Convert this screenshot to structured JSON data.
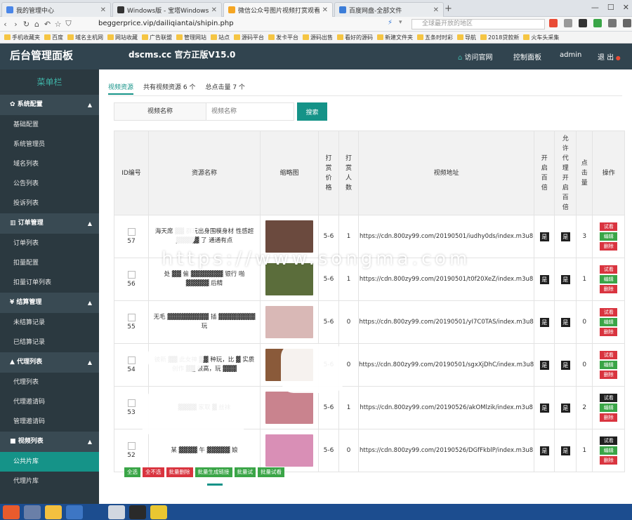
{
  "browser": {
    "tabs": [
      {
        "label": "我的管理中心",
        "icon_color": "#4a86e8"
      },
      {
        "label": "Windows版 - 宝塔Windows面板",
        "icon_color": "#333333"
      },
      {
        "label": "微信公众号图片视频打赏观看电影",
        "icon_color": "#f5a623"
      },
      {
        "label": "百度网盘-全部文件",
        "icon_color": "#3b7dd8"
      }
    ],
    "url": "beggerprice.vip/dailiqiantai/shipin.php",
    "search_placeholder": "全球最开放的地区",
    "bookmarks": [
      "手机收藏夹",
      "百度",
      "域名主机网",
      "网站收藏",
      "广告联盟",
      "管理网站",
      "站点",
      "源码平台",
      "发卡平台",
      "源码出售",
      "看好的源码",
      "新建文件夹",
      "五条时时彩",
      "导航",
      "2018贷款新",
      "火车头采集"
    ]
  },
  "header": {
    "brand": "后台管理面板",
    "title": "dscms.cc 官方正版V15.0",
    "visit_site": "访问官网",
    "control_panel": "控制面板",
    "user": "admin",
    "logout": "退 出"
  },
  "sidebar": {
    "title": "菜单栏",
    "sections": [
      {
        "label": "系统配置",
        "items": [
          "基础配置",
          "系统管理员",
          "域名列表",
          "公告列表",
          "投诉列表"
        ]
      },
      {
        "label": "订单管理",
        "items": [
          "订单列表",
          "扣量配置",
          "扣量订单列表"
        ]
      },
      {
        "label": "结算管理",
        "items": [
          "未结算记录",
          "已结算记录"
        ]
      },
      {
        "label": "代理列表",
        "items": [
          "代理列表",
          "代理邀请码",
          "管理邀请码"
        ]
      },
      {
        "label": "视频列表",
        "items": [
          "公共片库",
          "代理片库"
        ]
      }
    ],
    "active_item": "公共片库"
  },
  "main": {
    "tabs": [
      "视频资源",
      "共有视频资源 6 个",
      "总点击量 7 个"
    ],
    "filter": {
      "label": "视频名称",
      "placeholder": "视频名称",
      "button": "搜索"
    },
    "columns": [
      "ID编号",
      "资源名称",
      "缩略图",
      "打赏价格",
      "打赏人数",
      "视频地址",
      "开启百倍",
      "允许代理开启百倍",
      "点击量",
      "操作"
    ],
    "rows": [
      {
        "id": "57",
        "name": "海天席 ▓▓ 群玩出身围模身材 性感超 ▓▓▓▓▓ 了 通通有点",
        "thumb_color": "#6b4a3e",
        "price": "5-6",
        "count": "1",
        "url": "https://cdn.800zy99.com/20190501/iudhy0ds/index.m3u8",
        "hundred": "是",
        "agent_hundred": "是",
        "clicks": "3",
        "ops": [
          "试看",
          "编辑",
          "删除"
        ],
        "ops_first_color": "red"
      },
      {
        "id": "56",
        "name": "处 ▓▓ 偷 ▓▓▓▓▓▓▓ 银行 啪 ▓▓▓▓▓ 后精",
        "thumb_color": "#5b6d3b",
        "price": "5-6",
        "count": "1",
        "url": "https://cdn.800zy99.com/20190501/t0f20XeZ/index.m3u8",
        "hundred": "是",
        "agent_hundred": "是",
        "clicks": "1",
        "ops": [
          "试看",
          "编辑",
          "删除"
        ],
        "ops_first_color": "red"
      },
      {
        "id": "55",
        "name": "无毛 ▓▓▓▓▓▓▓▓▓ 插 ▓▓▓▓▓▓▓▓ 玩",
        "thumb_color": "#d9b8b6",
        "price": "5-6",
        "count": "0",
        "url": "https://cdn.800zy99.com/20190501/yI7C0TAS/index.m3u8",
        "hundred": "是",
        "agent_hundred": "是",
        "clicks": "0",
        "ops": [
          "试看",
          "编辑",
          "删除"
        ],
        "ops_first_color": "red"
      },
      {
        "id": "54",
        "name": "彼新 ▓▓ 此女神 ▓▓ 种玩，比 ▓ 实质创作 ▓▓ 很高，玩 ▓▓▓",
        "thumb_color": "#8a5a3a",
        "price": "5-6",
        "count": "0",
        "url": "https://cdn.800zy99.com/20190501/sgxXjDhC/index.m3u8",
        "hundred": "是",
        "agent_hundred": "是",
        "clicks": "0",
        "ops": [
          "试看",
          "编辑",
          "删除"
        ],
        "ops_first_color": "red"
      },
      {
        "id": "53",
        "name": "▓▓▓▓ 家取 ▓ 丝袜",
        "thumb_color": "#c9838e",
        "price": "5-6",
        "count": "1",
        "url": "https://cdn.800zy99.com/20190526/akOMlzik/index.m3u8",
        "hundred": "是",
        "agent_hundred": "是",
        "clicks": "2",
        "ops": [
          "试看",
          "编辑",
          "删除"
        ],
        "ops_first_color": "black"
      },
      {
        "id": "52",
        "name": "某 ▓▓▓▓ 午 ▓▓▓▓▓ 娘",
        "thumb_color": "#d98fb6",
        "price": "5-6",
        "count": "0",
        "url": "https://cdn.800zy99.com/20190526/DGfFkblP/index.m3u8",
        "hundred": "是",
        "agent_hundred": "是",
        "clicks": "1",
        "ops": [
          "试看",
          "编辑",
          "删除"
        ],
        "ops_first_color": "black"
      }
    ],
    "bulk_actions": [
      {
        "label": "全选",
        "color": "#3aa547"
      },
      {
        "label": "全不选",
        "color": "#d9343f"
      },
      {
        "label": "批量删除",
        "color": "#d9343f"
      },
      {
        "label": "批量生成链接",
        "color": "#3aa547"
      },
      {
        "label": "批量试",
        "color": "#3aa547"
      },
      {
        "label": "批量试看",
        "color": "#3aa547"
      }
    ]
  },
  "watermark": "https://www.songma.com"
}
